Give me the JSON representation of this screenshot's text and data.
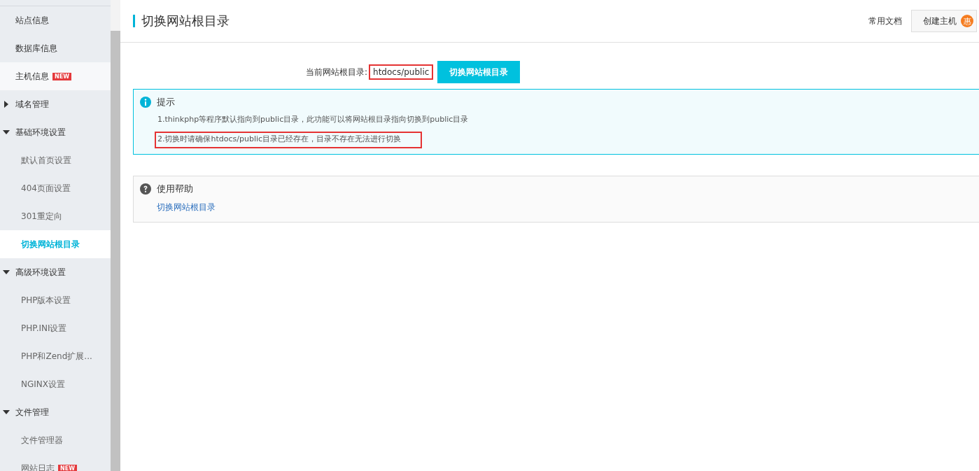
{
  "sidebar": {
    "items": [
      {
        "kind": "item",
        "label": "站点信息",
        "selected": false,
        "hovered": false
      },
      {
        "kind": "item",
        "label": "数据库信息",
        "selected": false,
        "hovered": false
      },
      {
        "kind": "item",
        "label": "主机信息",
        "badge": "NEW",
        "selected": false,
        "hovered": true
      },
      {
        "kind": "group",
        "label": "域名管理",
        "expanded": false,
        "selected": false,
        "hovered": false
      },
      {
        "kind": "group",
        "label": "基础环境设置",
        "expanded": true,
        "selected": false,
        "hovered": false,
        "children": [
          {
            "label": "默认首页设置",
            "selected": false
          },
          {
            "label": "404页面设置",
            "selected": false
          },
          {
            "label": "301重定向",
            "selected": false
          },
          {
            "label": "切换网站根目录",
            "selected": true
          }
        ]
      },
      {
        "kind": "group",
        "label": "高级环境设置",
        "expanded": true,
        "selected": false,
        "hovered": false,
        "children": [
          {
            "label": "PHP版本设置",
            "selected": false
          },
          {
            "label": "PHP.INI设置",
            "selected": false
          },
          {
            "label": "PHP和Zend扩展...",
            "selected": false
          },
          {
            "label": "NGINX设置",
            "selected": false
          }
        ]
      },
      {
        "kind": "group",
        "label": "文件管理",
        "expanded": true,
        "selected": false,
        "hovered": false,
        "children": [
          {
            "label": "文件管理器",
            "selected": false
          },
          {
            "label": "网站日志",
            "badge": "NEW",
            "selected": false
          }
        ]
      }
    ]
  },
  "header": {
    "title": "切换网站根目录",
    "docs_link": "常用文档",
    "create_button": "创建主机",
    "create_badge": "惠"
  },
  "form": {
    "label": "当前网站根目录:",
    "value": "htdocs/public",
    "value_highlighted": true,
    "button": "切换网站根目录"
  },
  "tip": {
    "title": "提示",
    "lines": [
      {
        "text": "1.thinkphp等程序默认指向到public目录，此功能可以将网站根目录指向切换到public目录",
        "highlighted": false
      },
      {
        "text": "2.切换时请确保htdocs/public目录已经存在，目录不存在无法进行切换",
        "highlighted": true
      }
    ]
  },
  "help": {
    "title": "使用帮助",
    "links": [
      "切换网站根目录"
    ]
  }
}
